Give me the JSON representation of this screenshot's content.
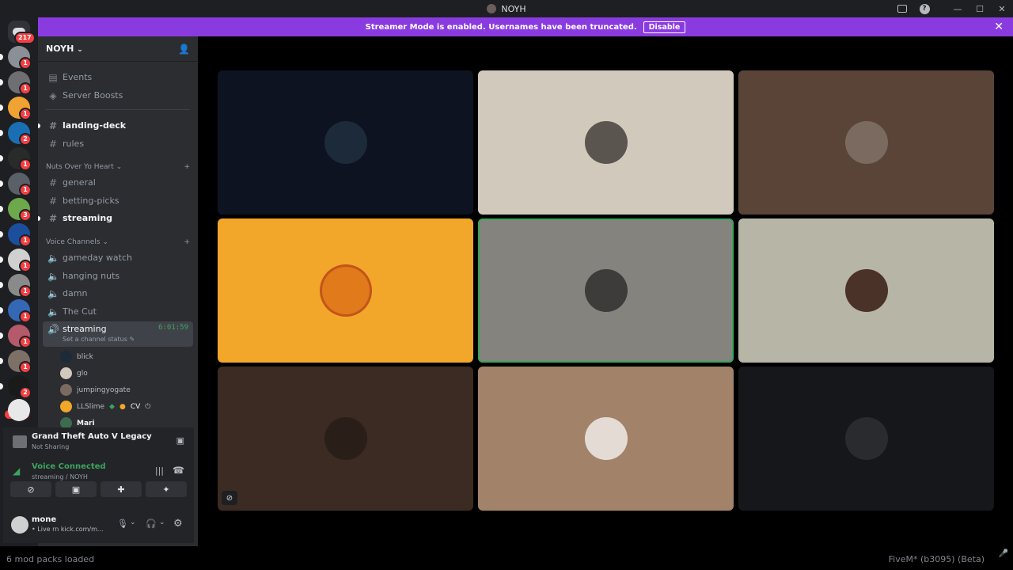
{
  "window": {
    "title": "NOYH"
  },
  "banner": {
    "text": "Streamer Mode is enabled. Usernames have been truncated.",
    "button": "Disable"
  },
  "rail": {
    "home_badge": "217",
    "new_label": "NEW",
    "servers": [
      {
        "badge": "1",
        "color": "#8b8f96"
      },
      {
        "badge": "1",
        "color": "#6f6f73"
      },
      {
        "badge": "1",
        "color": "#f0a232"
      },
      {
        "badge": "2",
        "color": "#1a6fb3"
      },
      {
        "badge": "1",
        "color": "#2a2a2a"
      },
      {
        "badge": "1",
        "color": "#5a6068"
      },
      {
        "badge": "3",
        "color": "#6da84b"
      },
      {
        "badge": "1",
        "color": "#1b4f9c"
      },
      {
        "badge": "1",
        "color": "#d0d0d0"
      },
      {
        "badge": "1",
        "color": "#8a8a8a"
      },
      {
        "badge": "1",
        "color": "#3468b5"
      },
      {
        "badge": "1",
        "color": "#b55a6a"
      },
      {
        "badge": "1",
        "color": "#7d7066"
      },
      {
        "badge": "2",
        "color": "#1a1a1a"
      }
    ]
  },
  "server": {
    "name": "NOYH",
    "top_items": [
      "Events",
      "Server Boosts"
    ],
    "channels": [
      "landing-deck",
      "rules"
    ],
    "category1": "Nuts Over Yo Heart",
    "cat1_channels": [
      "general",
      "betting-picks",
      "streaming"
    ],
    "category2": "Voice Channels",
    "voice_channels": [
      "gameday watch",
      "hanging nuts",
      "damn",
      "The Cut"
    ],
    "active_voice": {
      "name": "streaming",
      "timer": "6:01:59",
      "status": "Set a channel status"
    },
    "voice_users": [
      "blick",
      "glo",
      "jumpingyogate",
      "LLSlime",
      "Mari"
    ],
    "llslime_tag": "CV"
  },
  "activity": {
    "game": "Grand Theft Auto V Legacy",
    "sub": "Not Sharing"
  },
  "voice": {
    "status": "Voice Connected",
    "channel": "streaming / NOYH"
  },
  "user": {
    "name": "mone",
    "status": "• Live rn kick.com/m..."
  },
  "stage": {
    "tiles": [
      {
        "bg": "#0d1320",
        "pic": "#1c2a3a"
      },
      {
        "bg": "#d2c9bd",
        "pic": "#5a554f"
      },
      {
        "bg": "#5a4438",
        "pic": "#7a6a60"
      },
      {
        "bg": "#f2a62a",
        "pic": "#e07a1a"
      },
      {
        "bg": "#85837e",
        "pic": "#3d3c3a"
      },
      {
        "bg": "#b6b5a6",
        "pic": "#4a3228"
      },
      {
        "bg": "#3b2b22",
        "pic": "#2a1f18"
      },
      {
        "bg": "#a3826a",
        "pic": "#e4dcd4"
      },
      {
        "bg": "#16171a",
        "pic": "#2a2b2e"
      }
    ]
  },
  "statusbar": {
    "left": "6 mod packs loaded",
    "right": "FiveM* (b3095) (Beta)"
  }
}
